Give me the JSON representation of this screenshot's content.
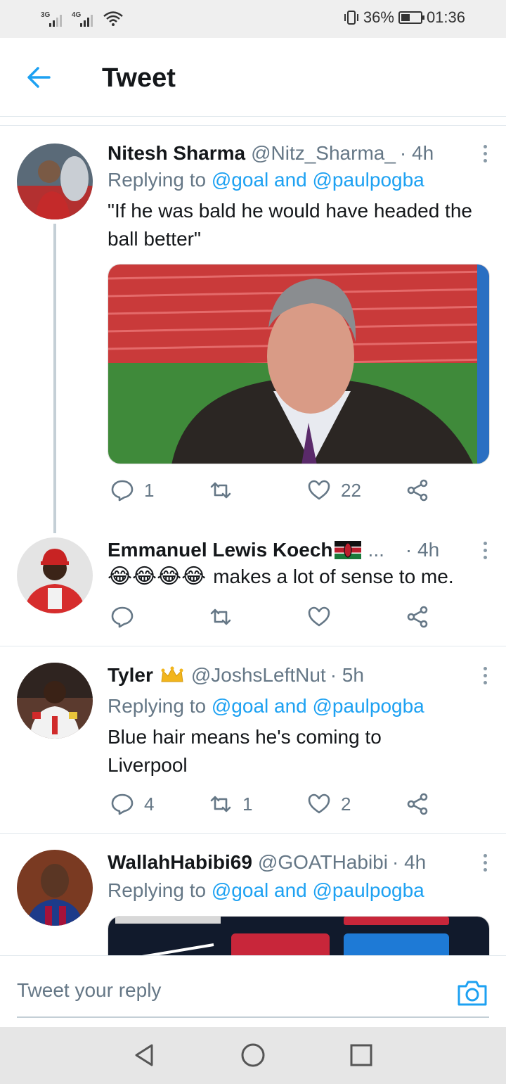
{
  "status_bar": {
    "net1": "3G",
    "net2": "4G",
    "battery": "36%",
    "time": "01:36"
  },
  "header": {
    "title": "Tweet"
  },
  "tweets": [
    {
      "name": "Nitesh Sharma",
      "handle": "@Nitz_Sharma_",
      "time": "· 4h",
      "replying_prefix": "Replying to",
      "replying_users": "@goal and @paulpogba",
      "text": "\"If he was bald he would have headed the ball better\"",
      "replies": "1",
      "retweets": "",
      "likes": "22"
    },
    {
      "name": "Emmanuel Lewis Koech",
      "handle": "...",
      "time": "· 4h",
      "text": "makes a lot of sense to me.",
      "emoji": "😂😂😂😂",
      "replies": "",
      "retweets": "",
      "likes": ""
    },
    {
      "name": "Tyler",
      "handle": "@JoshsLeftNut",
      "time": "· 5h",
      "replying_prefix": "Replying to",
      "replying_users": "@goal and @paulpogba",
      "text": "Blue hair means he's coming to Liverpool",
      "replies": "4",
      "retweets": "1",
      "likes": "2"
    },
    {
      "name": "WallahHabibi69",
      "handle": "@GOATHabibi",
      "time": "· 4h",
      "replying_prefix": "Replying to",
      "replying_users": "@goal and @paulpogba"
    }
  ],
  "reply_bar": {
    "placeholder": "Tweet your reply"
  },
  "colors": {
    "accent": "#1da1f2",
    "text": "#14171a",
    "secondary": "#657786",
    "divider": "#e1e8ed"
  },
  "icons": [
    "back-arrow-icon",
    "more-vertical-icon",
    "reply-icon",
    "retweet-icon",
    "like-icon",
    "share-icon",
    "camera-icon",
    "kenya-flag-icon",
    "crown-icon",
    "nav-back-icon",
    "nav-home-icon",
    "nav-recents-icon"
  ]
}
